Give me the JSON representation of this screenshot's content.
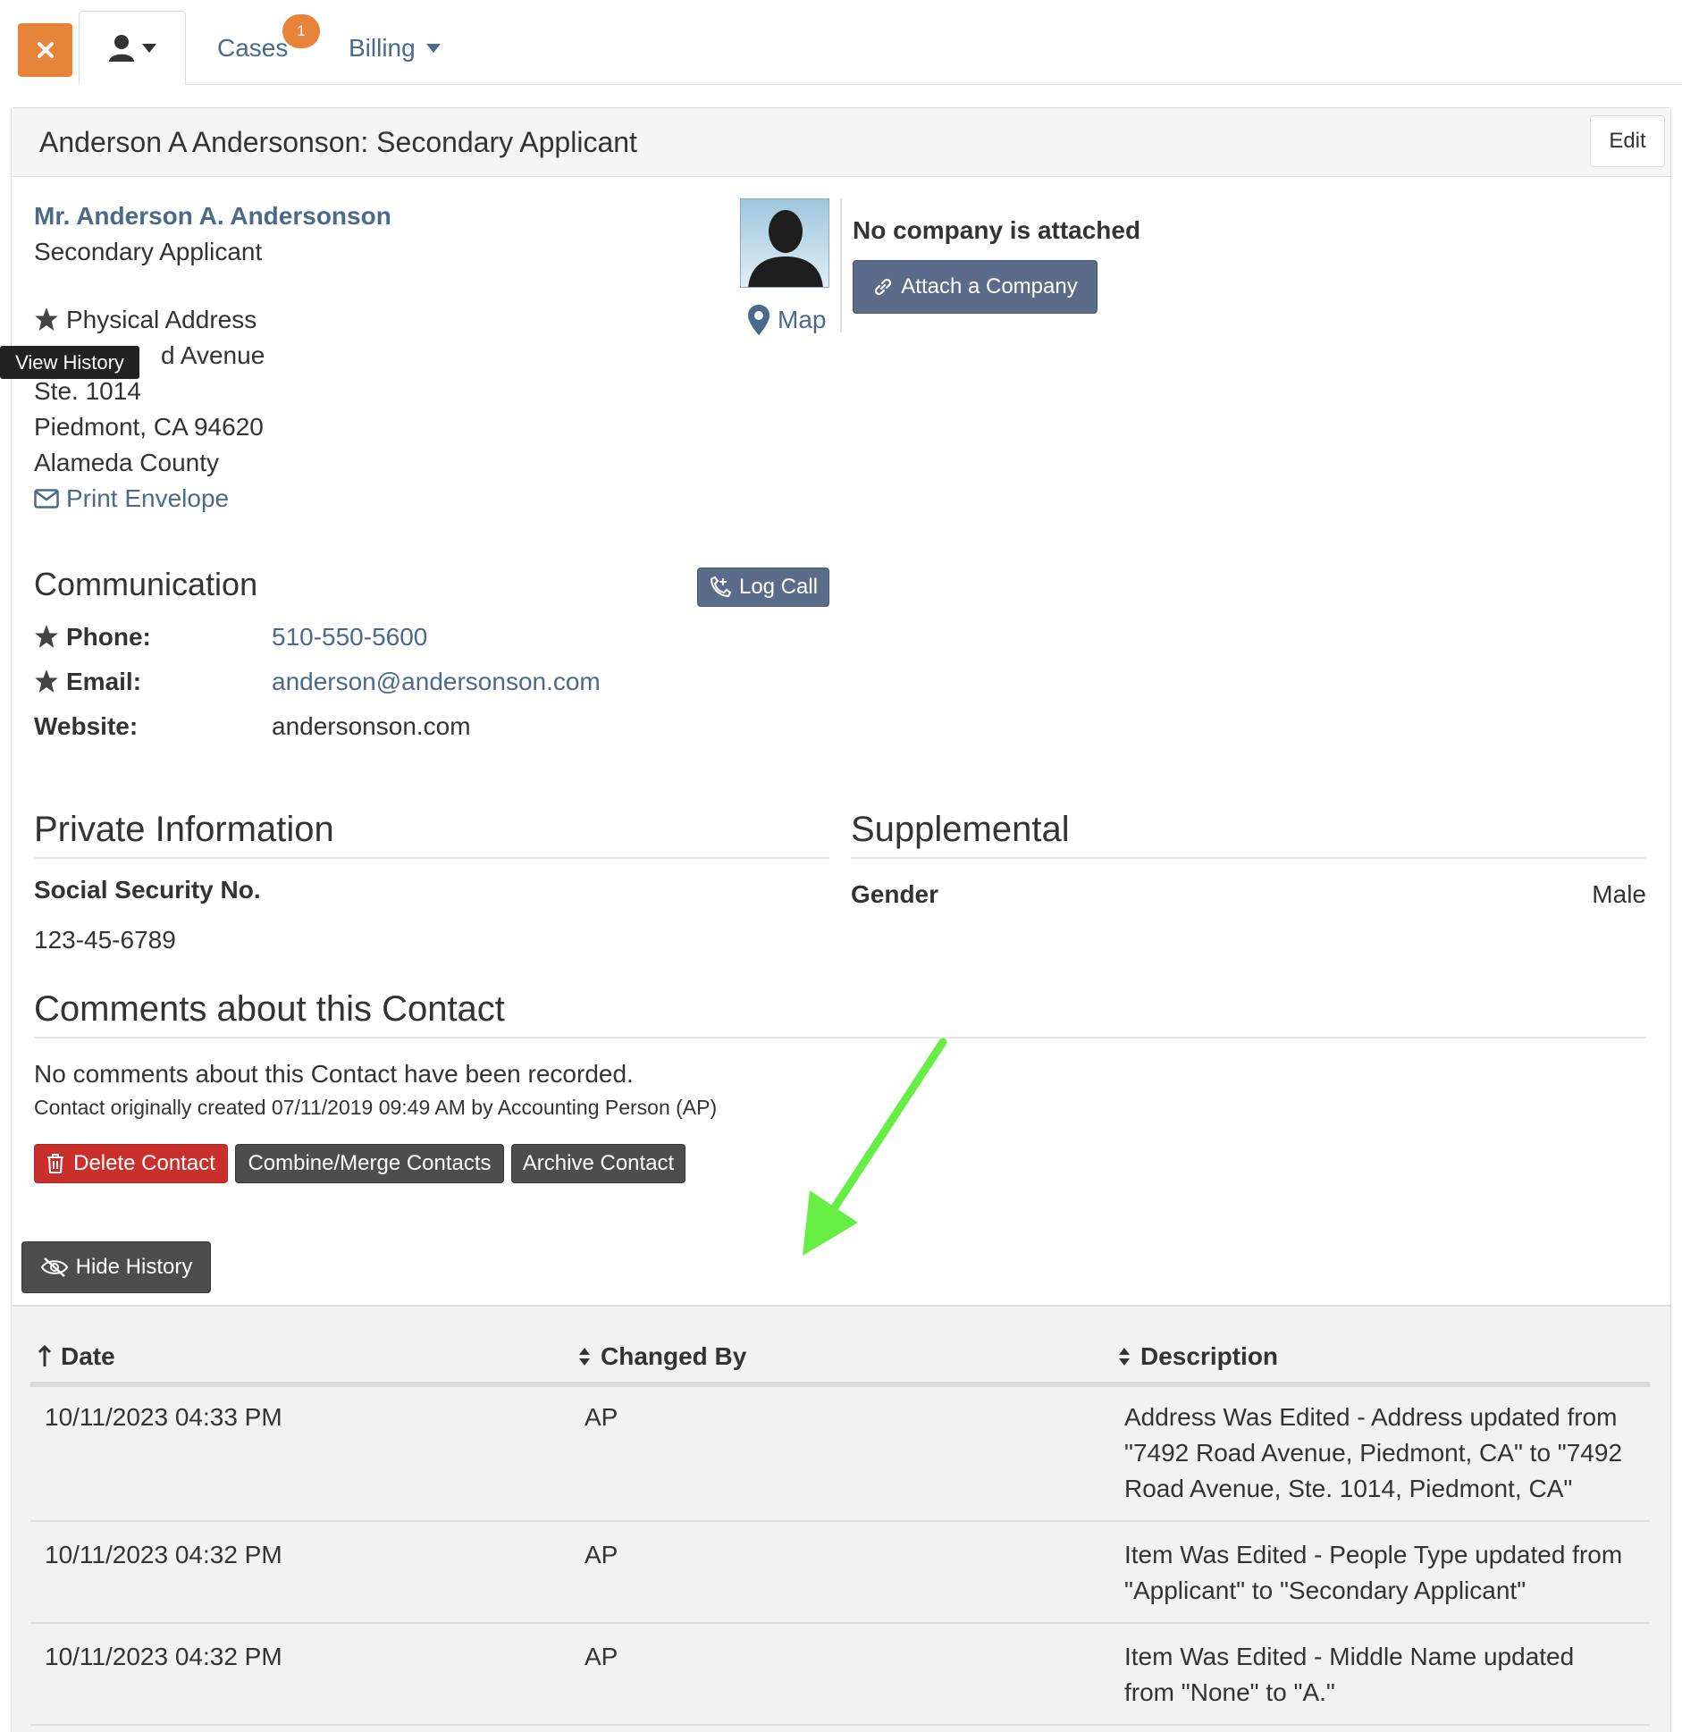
{
  "nav": {
    "cases_label": "Cases",
    "cases_badge": "1",
    "billing_label": "Billing"
  },
  "panel": {
    "title": "Anderson A Andersonson: Secondary Applicant",
    "edit_label": "Edit"
  },
  "contact": {
    "full_name": "Mr. Anderson A. Andersonson",
    "role": "Secondary Applicant",
    "address_label": "Physical Address",
    "address_line1": "d Avenue",
    "address_line2": "Ste. 1014",
    "address_line3": "Piedmont, CA 94620",
    "address_line4": "Alameda County",
    "print_envelope": "Print Envelope",
    "tooltip": "View History",
    "map_label": "Map"
  },
  "company": {
    "none_text": "No company is attached",
    "attach_label": "Attach a Company"
  },
  "communication": {
    "heading": "Communication",
    "log_call_label": "Log Call",
    "phone_label": "Phone:",
    "phone_value": "510-550-5600",
    "email_label": "Email:",
    "email_value": "anderson@andersonson.com",
    "website_label": "Website:",
    "website_value": "andersonson.com"
  },
  "private": {
    "heading": "Private Information",
    "ssn_label": "Social Security No.",
    "ssn_value": "123-45-6789"
  },
  "supplemental": {
    "heading": "Supplemental",
    "gender_label": "Gender",
    "gender_value": "Male"
  },
  "comments": {
    "heading": "Comments about this Contact",
    "empty_text": "No comments about this Contact have been recorded.",
    "created_text": "Contact originally created 07/11/2019 09:49 AM by Accounting Person (AP)"
  },
  "actions": {
    "delete_label": "Delete Contact",
    "merge_label": "Combine/Merge Contacts",
    "archive_label": "Archive Contact",
    "hide_history_label": "Hide History"
  },
  "history": {
    "columns": [
      "Date",
      "Changed By",
      "Description"
    ],
    "rows": [
      {
        "date": "10/11/2023 04:33 PM",
        "by": "AP",
        "desc": [
          "Address Was Edited - Address updated from",
          "\"7492 Road Avenue, Piedmont, CA\" to \"7492",
          "Road Avenue, Ste. 1014, Piedmont, CA\""
        ]
      },
      {
        "date": "10/11/2023 04:32 PM",
        "by": "AP",
        "desc": [
          "Item Was Edited - People Type updated from",
          "\"Applicant\" to \"Secondary Applicant\""
        ]
      },
      {
        "date": "10/11/2023 04:32 PM",
        "by": "AP",
        "desc": [
          "Item Was Edited - Middle Name updated",
          "from \"None\" to \"A.\""
        ]
      }
    ]
  },
  "colors": {
    "accent_orange": "#e8833a",
    "link_blue": "#4a6a8c",
    "button_slate": "#5b6c8a",
    "danger_red": "#c9302c",
    "annotation_green": "#66ee44"
  }
}
